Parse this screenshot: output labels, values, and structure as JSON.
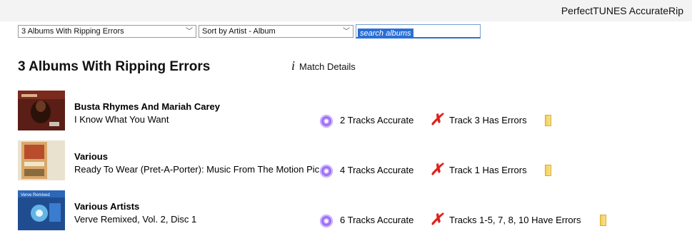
{
  "app": {
    "title": "PerfectTUNES AccurateRip"
  },
  "toolbar": {
    "filter_value": "3 Albums With Ripping Errors",
    "sort_value": "Sort by Artist - Album",
    "search_placeholder": "search albums"
  },
  "main": {
    "heading": "3 Albums With Ripping Errors",
    "match_details_label": "Match Details"
  },
  "albums": [
    {
      "artist": "Busta Rhymes And Mariah Carey",
      "album": "I Know What You Want",
      "accurate": "2 Tracks Accurate",
      "errors": "Track 3 Has Errors"
    },
    {
      "artist": "Various",
      "album": "Ready To Wear (Pret-A-Porter): Music From The Motion Pic..",
      "accurate": "4 Tracks Accurate",
      "errors": "Track 1 Has Errors"
    },
    {
      "artist": "Various Artists",
      "album": "Verve Remixed, Vol. 2, Disc 1",
      "accurate": "6 Tracks Accurate",
      "errors": "Tracks 1-5, 7, 8, 10 Have Errors",
      "cover_text": "Verve Remixed"
    }
  ],
  "icons": {
    "info": "info-icon",
    "accurate": "disc-icon",
    "error": "error-x-icon",
    "folder": "folder-icon"
  },
  "colors": {
    "error": "#e0201b",
    "selection": "#2a6fd6"
  }
}
